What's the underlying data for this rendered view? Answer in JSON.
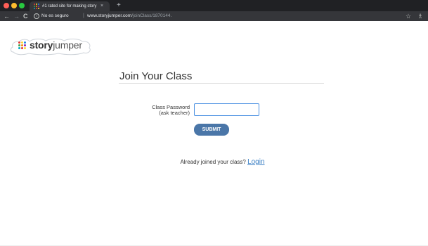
{
  "browser": {
    "tab_title": "#1 rated site for making story",
    "tab_close": "×",
    "new_tab": "+",
    "nav_back": "←",
    "nav_forward": "→",
    "reload": "C",
    "info_icon": "i",
    "security_label": "No es seguro",
    "url_separator": "|",
    "url_host": "www.storyjumper.com",
    "url_path": "/joinClass/1870144.",
    "star_icon": "☆",
    "extension_icon": "♗"
  },
  "logo": {
    "part1": "story",
    "part2": "jumper",
    "dot_colors": [
      "#e53935",
      "#fdd835",
      "#1e88e5",
      "#43a047",
      "#fb8c00",
      "#8e24aa",
      "#00acc1",
      "#e53935",
      "#fdd835"
    ]
  },
  "page": {
    "heading": "Join Your Class",
    "password_label_line1": "Class Password",
    "password_label_line2": "(ask teacher)",
    "password_value": "",
    "submit_label": "SUBMIT",
    "already_joined_text": "Already joined your class? ",
    "login_link": "Login"
  },
  "colors": {
    "accent_button": "#4a76a8",
    "input_border": "#4a90e2",
    "link": "#3a7fc4"
  }
}
